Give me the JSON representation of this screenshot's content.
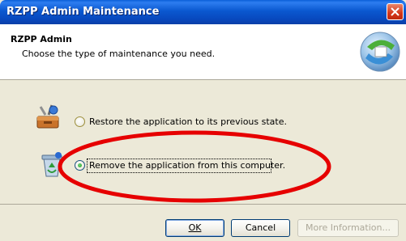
{
  "window": {
    "title": "RZPP Admin Maintenance"
  },
  "header": {
    "title": "RZPP Admin",
    "subtitle": "Choose the type of maintenance you need."
  },
  "options": [
    {
      "label": "Restore the application to its previous state.",
      "selected": false,
      "icon": "repair-toolbox-icon"
    },
    {
      "label": "Remove the application from this computer.",
      "selected": true,
      "icon": "recycle-bin-icon"
    }
  ],
  "buttons": {
    "ok_label": "OK",
    "cancel_label": "Cancel",
    "more_info_label": "More Information..."
  },
  "annotation": {
    "color": "#e60000"
  }
}
